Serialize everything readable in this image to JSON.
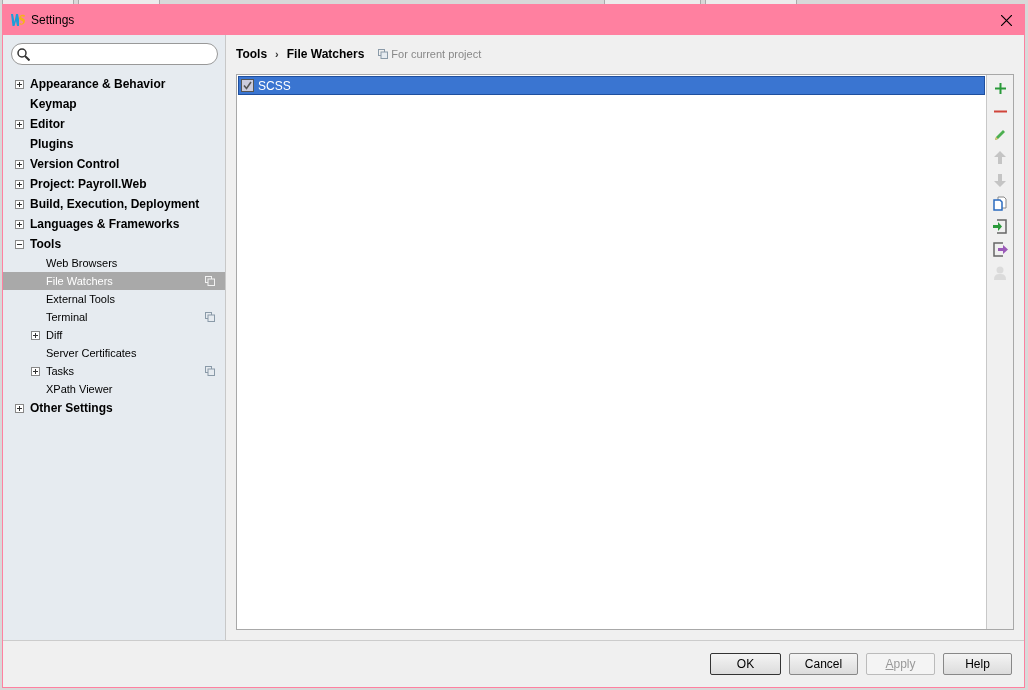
{
  "window": {
    "title": "Settings"
  },
  "sidebar": {
    "items": [
      {
        "label": "Appearance & Behavior",
        "selected": false,
        "expanded": false
      },
      {
        "label": "Keymap",
        "selected": false
      },
      {
        "label": "Editor",
        "selected": false,
        "expanded": false
      },
      {
        "label": "Plugins",
        "selected": false
      },
      {
        "label": "Version Control",
        "selected": false,
        "expanded": false
      },
      {
        "label": "Project: Payroll.Web",
        "selected": false,
        "expanded": false
      },
      {
        "label": "Build, Execution, Deployment",
        "selected": false,
        "expanded": false
      },
      {
        "label": "Languages & Frameworks",
        "selected": false,
        "expanded": false
      },
      {
        "label": "Tools",
        "selected": false,
        "expanded": true,
        "children": [
          {
            "label": "Web Browsers",
            "selected": false
          },
          {
            "label": "File Watchers",
            "selected": true,
            "project_scope": true
          },
          {
            "label": "External Tools",
            "selected": false
          },
          {
            "label": "Terminal",
            "selected": false,
            "project_scope": true
          },
          {
            "label": "Diff",
            "selected": false,
            "expanded": false
          },
          {
            "label": "Server Certificates",
            "selected": false
          },
          {
            "label": "Tasks",
            "selected": false,
            "expanded": false,
            "project_scope": true
          },
          {
            "label": "XPath Viewer",
            "selected": false
          }
        ]
      },
      {
        "label": "Other Settings",
        "selected": false,
        "expanded": false
      }
    ]
  },
  "breadcrumb": [
    "Tools",
    "File Watchers"
  ],
  "breadcrumb_separator": "›",
  "scope_note": "For current project",
  "watchers": [
    {
      "name": "SCSS",
      "checked": true,
      "selected": true
    }
  ],
  "toolbar": [
    {
      "kind": "add",
      "disabled": false
    },
    {
      "kind": "remove",
      "disabled": false
    },
    {
      "kind": "edit",
      "disabled": false
    },
    {
      "kind": "up",
      "disabled": true
    },
    {
      "kind": "down",
      "disabled": true
    },
    {
      "kind": "copy",
      "disabled": false
    },
    {
      "kind": "import",
      "disabled": false
    },
    {
      "kind": "export",
      "disabled": false
    },
    {
      "kind": "person",
      "disabled": true
    }
  ],
  "buttons": [
    {
      "label": "OK",
      "disabled": false,
      "default": true
    },
    {
      "label": "Cancel",
      "disabled": false,
      "default": false
    },
    {
      "label": "Apply",
      "disabled": true,
      "default": false,
      "mnemonic": true
    },
    {
      "label": "Help",
      "disabled": false,
      "default": false
    }
  ]
}
